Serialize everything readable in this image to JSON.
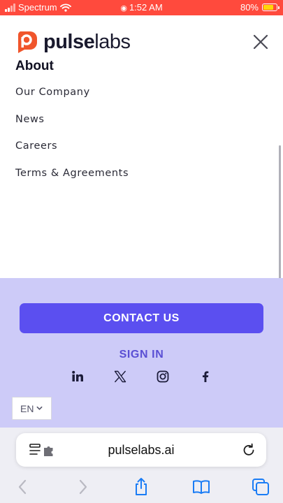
{
  "status_bar": {
    "carrier": "Spectrum",
    "time": "1:52 AM",
    "battery_percent": "80%",
    "battery_level": 0.8
  },
  "header": {
    "logo_bold": "pulse",
    "logo_light": "labs",
    "icons": {
      "logo": "pulselabs-logo-icon",
      "close": "close-icon"
    }
  },
  "nav": {
    "heading": "About",
    "items": [
      {
        "label": "Our Company"
      },
      {
        "label": "News"
      },
      {
        "label": "Careers"
      },
      {
        "label": "Terms & Agreements"
      }
    ]
  },
  "footer": {
    "contact_label": "CONTACT US",
    "sign_in_label": "SIGN IN",
    "social": [
      "linkedin-icon",
      "x-icon",
      "instagram-icon",
      "facebook-icon"
    ],
    "language": "EN"
  },
  "browser": {
    "url": "pulselabs.ai",
    "icons": [
      "reader-icon",
      "extension-icon",
      "reload-icon",
      "back-icon",
      "forward-icon",
      "share-icon",
      "bookmarks-icon",
      "tabs-icon"
    ]
  },
  "colors": {
    "status_bar": "#ff4a3d",
    "brand_orange": "#f0552b",
    "accent": "#5b4ff0",
    "footer_bg": "#cdcbf8",
    "link_blue": "#1a7cf5"
  }
}
